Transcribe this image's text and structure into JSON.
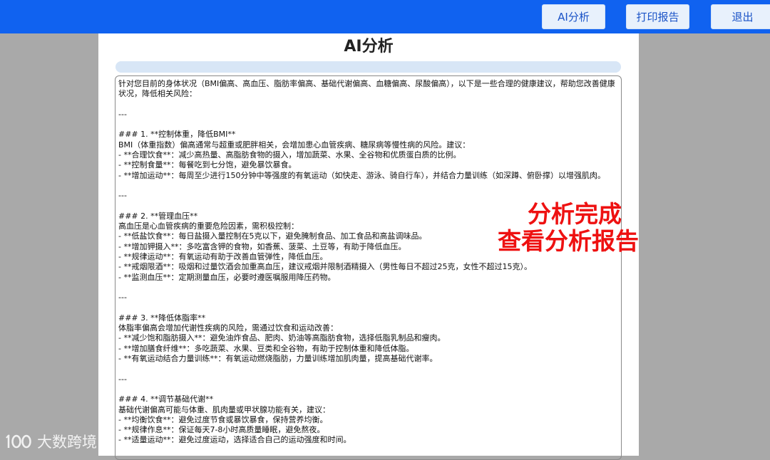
{
  "topbar": {
    "ai_button": "AI分析",
    "print_button": "打印报告",
    "exit_button": "退出"
  },
  "page": {
    "title": "AI分析",
    "progress": 1.0
  },
  "report": {
    "text": "针对您目前的身体状况（BMI偏高、高血压、脂肪率偏高、基础代谢偏高、血糖偏高、尿酸偏高），以下是一些合理的健康建议，帮助您改善健康状况，降低相关风险：\n\n---\n\n### 1. **控制体重，降低BMI**\nBMI（体重指数）偏高通常与超重或肥胖相关，会增加患心血管疾病、糖尿病等慢性病的风险。建议：\n- **合理饮食**：减少高热量、高脂肪食物的摄入，增加蔬菜、水果、全谷物和优质蛋白质的比例。\n- **控制食量**：每餐吃到七分饱，避免暴饮暴食。\n- **增加运动**：每周至少进行150分钟中等强度的有氧运动（如快走、游泳、骑自行车），并结合力量训练（如深蹲、俯卧撑）以增强肌肉。\n\n---\n\n### 2. **管理血压**\n高血压是心血管疾病的重要危险因素，需积极控制：\n- **低盐饮食**：每日盐摄入量控制在5克以下，避免腌制食品、加工食品和高盐调味品。\n- **增加钾摄入**：多吃富含钾的食物，如香蕉、菠菜、土豆等，有助于降低血压。\n- **规律运动**：有氧运动有助于改善血管弹性，降低血压。\n- **戒烟限酒**：吸烟和过量饮酒会加重高血压，建议戒烟并限制酒精摄入（男性每日不超过25克，女性不超过15克）。\n- **监测血压**：定期测量血压，必要时遵医嘱服用降压药物。\n\n---\n\n### 3. **降低体脂率**\n体脂率偏高会增加代谢性疾病的风险，需通过饮食和运动改善：\n- **减少饱和脂肪摄入**：避免油炸食品、肥肉、奶油等高脂肪食物，选择低脂乳制品和瘦肉。\n- **增加膳食纤维**：多吃蔬菜、水果、豆类和全谷物，有助于控制体重和降低体脂。\n- **有氧运动结合力量训练**：有氧运动燃烧脂肪，力量训练增加肌肉量，提高基础代谢率。\n\n---\n\n### 4. **调节基础代谢**\n基础代谢偏高可能与体重、肌肉量或甲状腺功能有关，建议：\n- **均衡饮食**：避免过度节食或暴饮暴食，保持营养均衡。\n- **规律作息**：保证每天7-8小时高质量睡眠，避免熬夜。\n- **适量运动**：避免过度运动，选择适合自己的运动强度和时间。"
  },
  "overlay": {
    "line1": "分析完成",
    "line2": "查看分析报告"
  },
  "watermark": {
    "logo_text": "100",
    "text": "大数跨境"
  },
  "colors": {
    "topbar": "#1062f0",
    "button_bg": "#e8f1fc",
    "overlay_text": "#ee1111",
    "background": "#a9a9a9"
  }
}
